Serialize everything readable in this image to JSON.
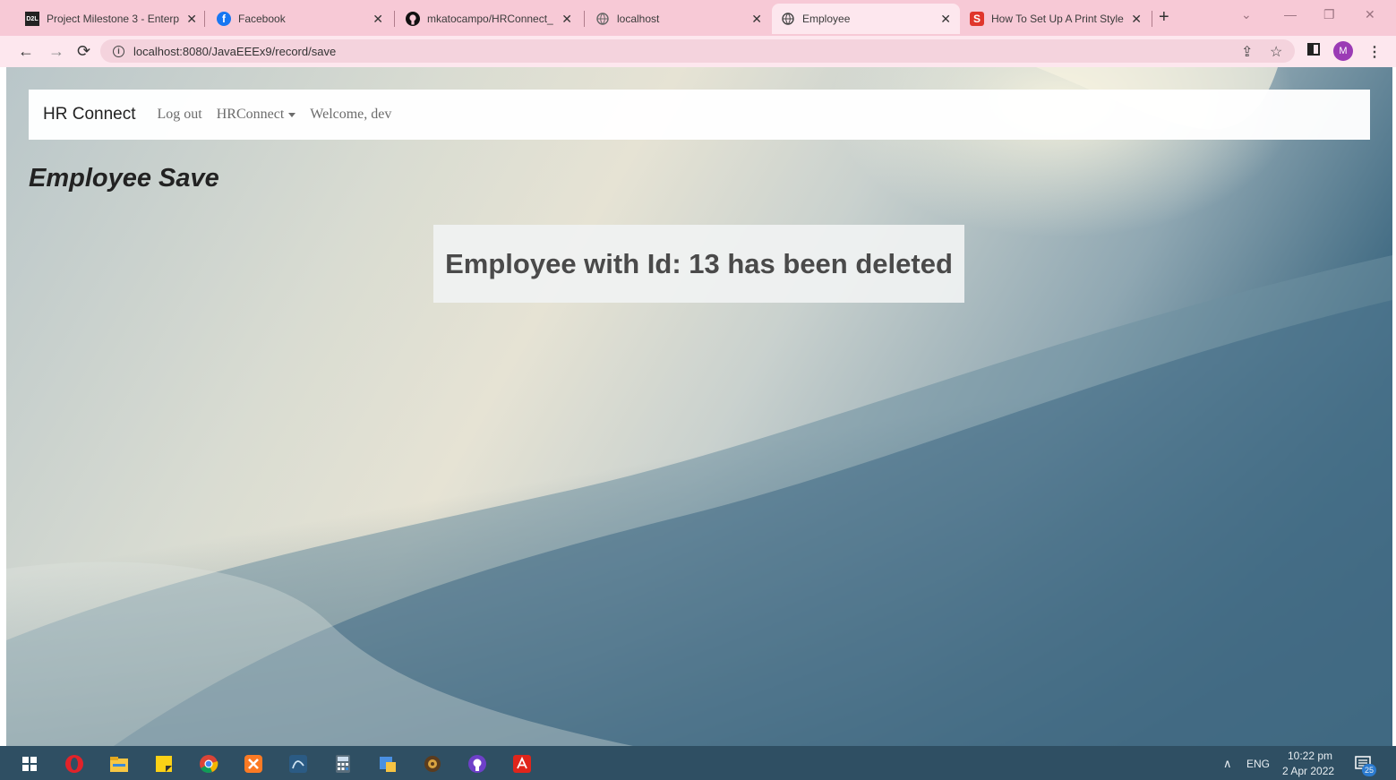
{
  "browser": {
    "tabs": [
      {
        "label": "Project Milestone 3 - Enterp",
        "favicon": "d2l-icon",
        "favicon_text": "D2L"
      },
      {
        "label": "Facebook",
        "favicon": "facebook-icon",
        "favicon_text": "f"
      },
      {
        "label": "mkatocampo/HRConnect_",
        "favicon": "github-icon"
      },
      {
        "label": "localhost",
        "favicon": "globe-icon"
      },
      {
        "label": "Employee",
        "favicon": "globe-icon",
        "active": true
      },
      {
        "label": "How To Set Up A Print Style",
        "favicon": "shopify-s-icon",
        "favicon_text": "S"
      }
    ],
    "url": "localhost:8080/JavaEEEx9/record/save",
    "profile_initial": "M"
  },
  "app": {
    "brand": "HR Connect",
    "nav": {
      "logout": "Log out",
      "menu": "HRConnect",
      "welcome": "Welcome, dev"
    },
    "page_title": "Employee Save",
    "message": "Employee with Id: 13 has been deleted"
  },
  "taskbar": {
    "language": "ENG",
    "time": "10:22 pm",
    "date": "2 Apr 2022",
    "notification_count": "25"
  },
  "colors": {
    "tabstrip": "#f7c9d6",
    "toolbar": "#fde7ee",
    "taskbar": "#2f4f63",
    "facebook": "#1877f2",
    "shopify_red": "#e0362c"
  }
}
